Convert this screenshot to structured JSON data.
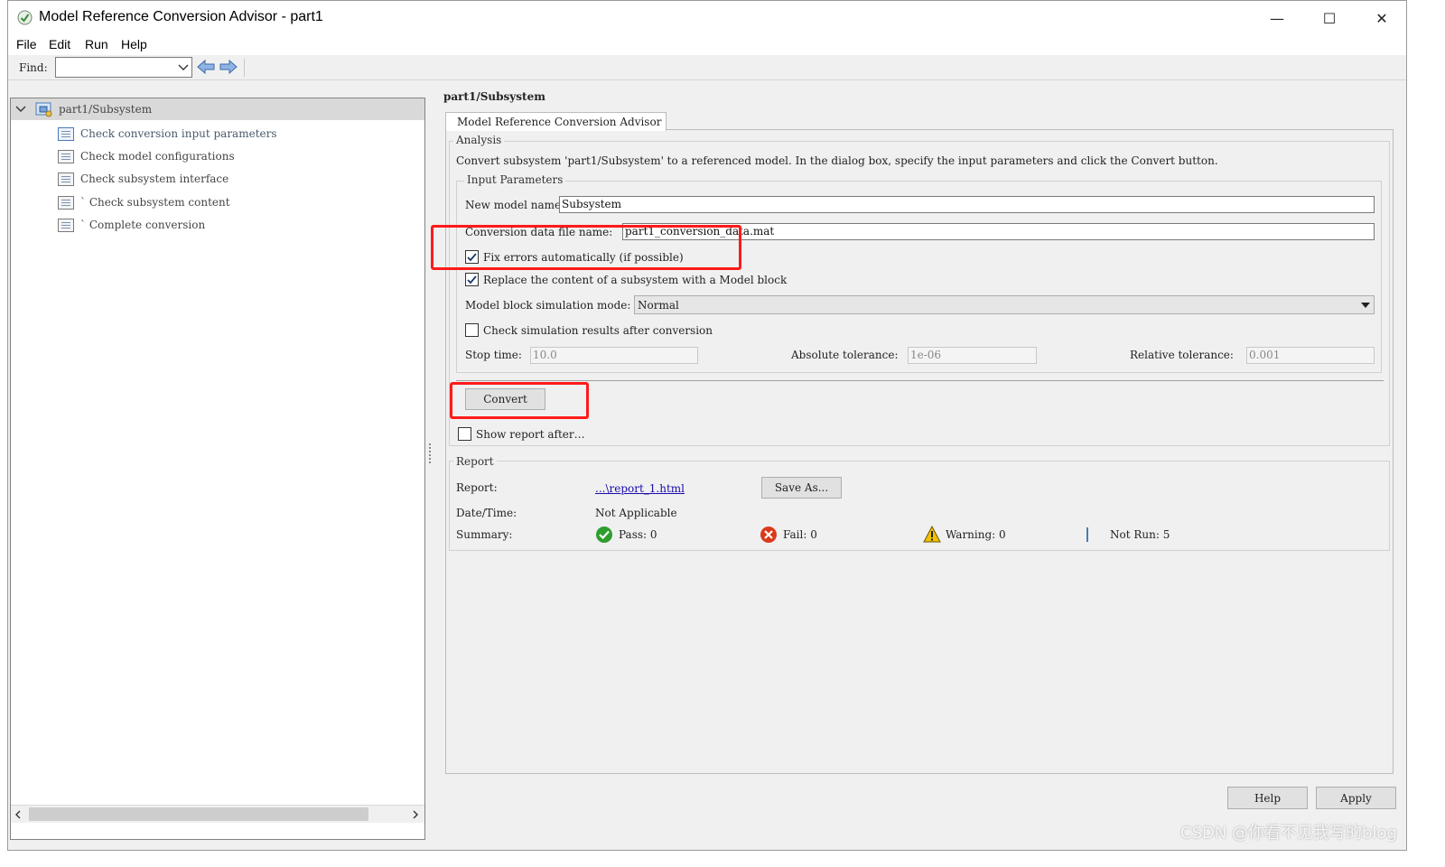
{
  "window": {
    "title": "Model Reference Conversion Advisor - part1",
    "controls": {
      "minimize": "—",
      "maximize": "☐",
      "close": "✕"
    }
  },
  "menu": [
    "File",
    "Edit",
    "Run",
    "Help"
  ],
  "toolbar": {
    "find_label": "Find:",
    "find_value": ""
  },
  "tree": {
    "root": "part1/Subsystem",
    "items": [
      "Check conversion input parameters",
      "Check model configurations",
      "Check subsystem interface",
      "` Check subsystem content",
      "` Complete conversion"
    ]
  },
  "right": {
    "path": "part1/Subsystem",
    "tab": "Model Reference Conversion Advisor",
    "analysis": {
      "legend": "Analysis",
      "description": "Convert subsystem 'part1/Subsystem' to a referenced model. In the dialog box, specify the input parameters and click the Convert button.",
      "input_params": {
        "legend": "Input Parameters",
        "new_model_label": "New model name:",
        "new_model_value": "Subsystem",
        "conv_file_label": "Conversion data file name:",
        "conv_file_value": "part1_conversion_data.mat",
        "fix_errors_label": "Fix errors automatically (if possible)",
        "fix_errors_checked": true,
        "replace_label": "Replace the content of a subsystem with a Model block",
        "replace_checked": true,
        "sim_mode_label": "Model block simulation mode:",
        "sim_mode_value": "Normal",
        "check_sim_label": "Check simulation results after conversion",
        "check_sim_checked": false,
        "stop_time_label": "Stop time:",
        "stop_time_value": "10.0",
        "abs_tol_label": "Absolute tolerance:",
        "abs_tol_value": "1e-06",
        "rel_tol_label": "Relative tolerance:",
        "rel_tol_value": "0.001"
      },
      "convert_button": "Convert",
      "show_report_label": "Show report after…",
      "show_report_checked": false
    },
    "report": {
      "legend": "Report",
      "report_label": "Report:",
      "report_link": "...\\report_1.html",
      "save_as": "Save As...",
      "datetime_label": "Date/Time:",
      "datetime_value": "Not Applicable",
      "summary_label": "Summary:",
      "pass": "Pass: 0",
      "fail": "Fail: 0",
      "warning": "Warning: 0",
      "not_run": "Not Run: 5"
    },
    "buttons": {
      "help": "Help",
      "apply": "Apply"
    }
  },
  "watermark": "CSDN @你看不见我写的blog",
  "colors": {
    "highlight": "#ff1a1a",
    "link": "#1a0dab",
    "pass": "#2e9e2e",
    "fail": "#d83b1a",
    "warning": "#f2c200"
  }
}
